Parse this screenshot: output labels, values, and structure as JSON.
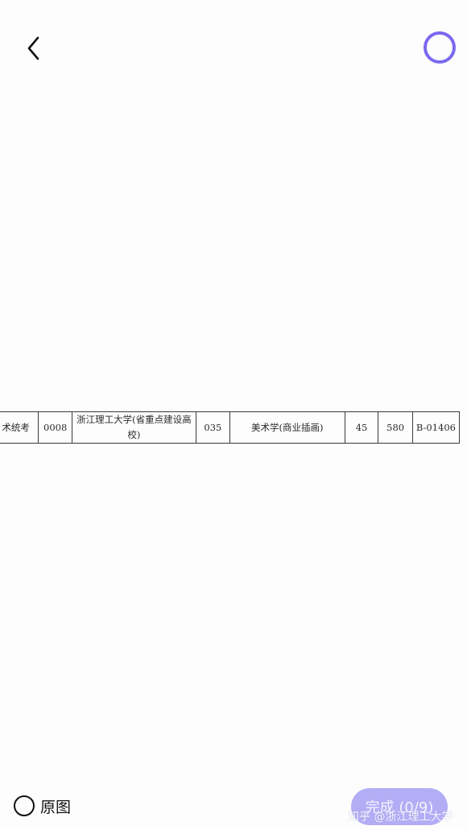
{
  "header": {
    "back_icon": "chevron-left-icon",
    "select_icon": "circle-select-icon"
  },
  "photo": {
    "row": {
      "exam_type": "术统考",
      "school_code": "0008",
      "school_name": "浙江理工大学(省重点建设高校)",
      "major_code": "035",
      "major_name": "美术学(商业插画)",
      "plan_count": "45",
      "score": "580",
      "rank_code": "B-01406"
    }
  },
  "footer": {
    "original_label": "原图",
    "done_label": "完成 (0/9)",
    "watermark": "知乎 @浙江理工大学"
  },
  "colors": {
    "accent": "#7a68f0",
    "done_button_bg": "#b3adf5",
    "background": "#fdfdfd"
  }
}
